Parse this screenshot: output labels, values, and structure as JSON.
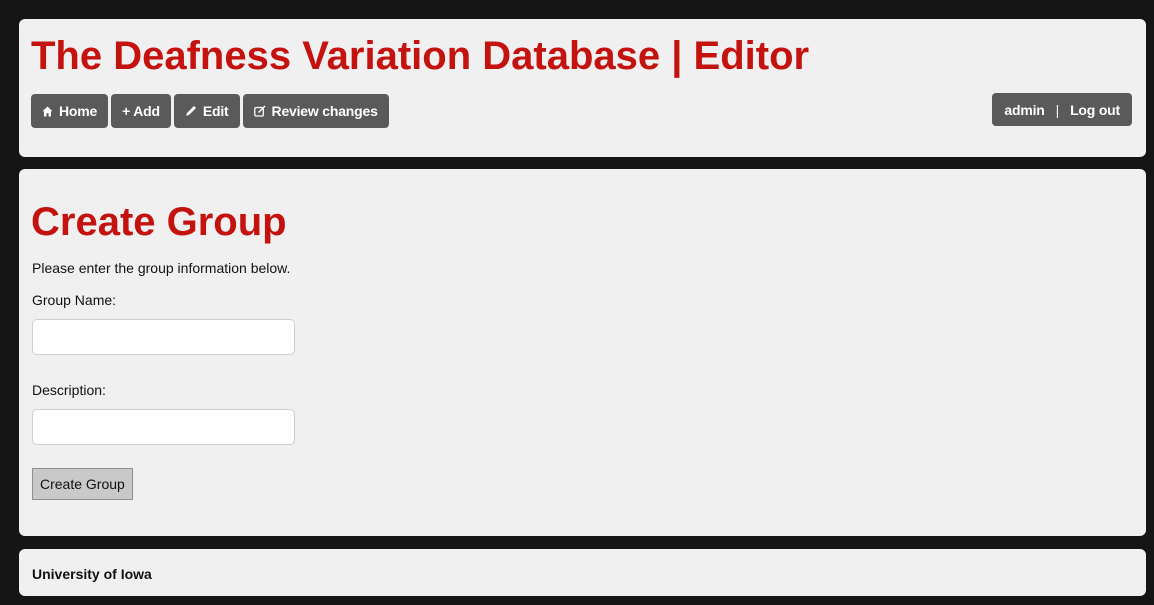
{
  "header": {
    "title": "The Deafness Variation Database | Editor",
    "nav": [
      {
        "label": "Home",
        "icon": "home-icon"
      },
      {
        "label": "+ Add",
        "icon": "plus-icon"
      },
      {
        "label": "Edit",
        "icon": "pencil-icon"
      },
      {
        "label": "Review changes",
        "icon": "review-icon"
      }
    ],
    "user": {
      "name": "admin",
      "separator": "|",
      "logout_label": "Log out"
    }
  },
  "main": {
    "title": "Create Group",
    "intro": "Please enter the group information below.",
    "fields": [
      {
        "label": "Group Name:",
        "value": ""
      },
      {
        "label": "Description:",
        "value": ""
      }
    ],
    "submit_label": "Create Group"
  },
  "footer": {
    "text": "University of Iowa"
  },
  "colors": {
    "title_red": "#c4120f",
    "nav_bg": "#5a5a5a",
    "panel_bg": "#f0f0f0",
    "page_bg": "#151515"
  }
}
